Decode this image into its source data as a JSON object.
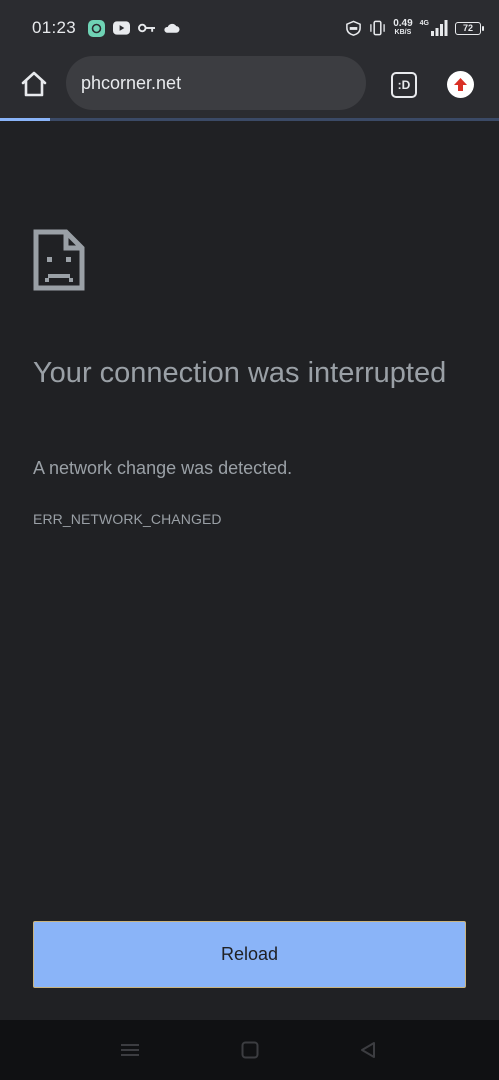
{
  "status_bar": {
    "time": "01:23",
    "speed_value": "0.49",
    "speed_unit": "KB/S",
    "network_label": "4G",
    "battery": "72",
    "icons": [
      "app-icon",
      "youtube-icon",
      "key-icon",
      "cloud-icon",
      "vpn-icon",
      "vibrate-icon",
      "signal-icon",
      "battery-icon"
    ]
  },
  "toolbar": {
    "url": "phcorner.net",
    "tab_label": ":D",
    "icons": [
      "home-icon",
      "tab-switcher-icon",
      "update-icon"
    ]
  },
  "page_load_progress": 0.1,
  "error": {
    "title": "Your connection was interrupted",
    "description": "A network change was detected.",
    "code": "ERR_NETWORK_CHANGED",
    "icon": "sad-document-icon"
  },
  "reload_label": "Reload",
  "colors": {
    "background": "#202124",
    "accent": "#8ab4f8",
    "text": "#9aa0a6",
    "bar": "#2b2c30"
  },
  "nav_bar": {
    "icons": [
      "menu-icon",
      "home-square-icon",
      "back-icon"
    ]
  }
}
